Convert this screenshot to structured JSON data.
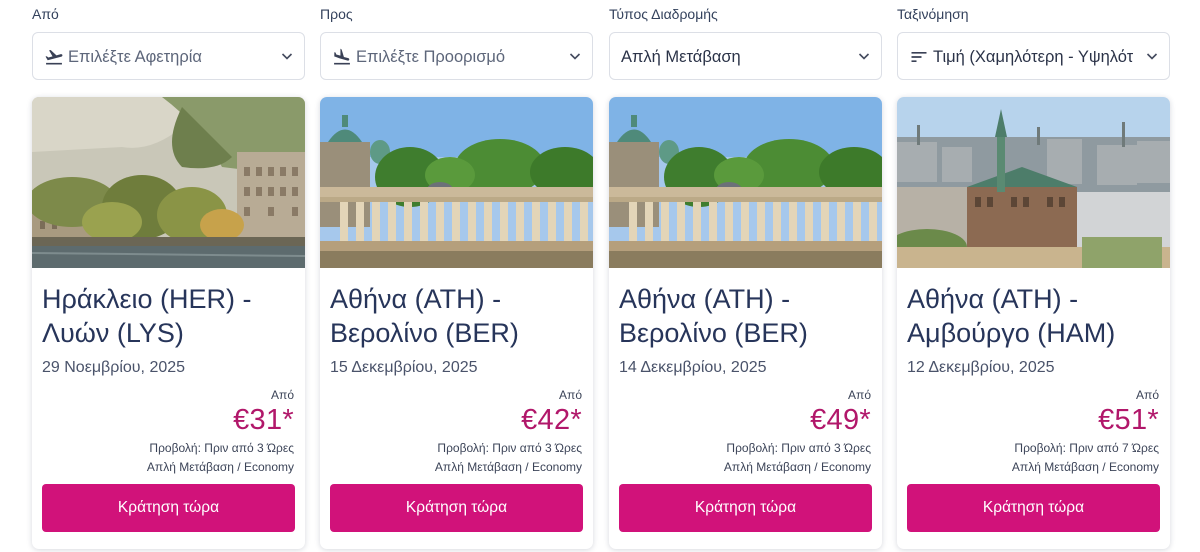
{
  "filters": [
    {
      "label": "Από",
      "value": "Επιλέξτε Αφετηρία",
      "icon": "plane-takeoff-icon",
      "is_placeholder": true
    },
    {
      "label": "Προς",
      "value": "Επιλέξτε Προορισμό",
      "icon": "plane-landing-icon",
      "is_placeholder": true
    },
    {
      "label": "Τύπος Διαδρομής",
      "value": "Απλή Μετάβαση",
      "icon": null,
      "is_placeholder": false
    },
    {
      "label": "Ταξινόμηση",
      "value": "Τιμή (Χαμηλότερη - Υψηλότ",
      "icon": "sort-icon",
      "is_placeholder": false
    }
  ],
  "cards": [
    {
      "image": "lyon-riverside-image",
      "route_line1": "Ηράκλειο (HER) -",
      "route_line2": "Λυών (LYS)",
      "date": "29 Νοεμβρίου, 2025",
      "from_label": "Από",
      "price": "€31*",
      "note": "Προβολή: Πριν από 3 Ώρες",
      "trip_info": "Απλή Μετάβαση  /  Economy",
      "button": "Κράτηση τώρα"
    },
    {
      "image": "berlin-colonnade-image",
      "route_line1": "Αθήνα (ATH) -",
      "route_line2": "Βερολίνο (BER)",
      "date": "15 Δεκεμβρίου, 2025",
      "from_label": "Από",
      "price": "€42*",
      "note": "Προβολή: Πριν από 3 Ώρες",
      "trip_info": "Απλή Μετάβαση  /  Economy",
      "button": "Κράτηση τώρα"
    },
    {
      "image": "berlin-colonnade-image",
      "route_line1": "Αθήνα (ATH) -",
      "route_line2": "Βερολίνο (BER)",
      "date": "14 Δεκεμβρίου, 2025",
      "from_label": "Από",
      "price": "€49*",
      "note": "Προβολή: Πριν από 3 Ώρες",
      "trip_info": "Απλή Μετάβαση  /  Economy",
      "button": "Κράτηση τώρα"
    },
    {
      "image": "hamburg-cityscape-image",
      "route_line1": "Αθήνα (ATH) -",
      "route_line2": "Αμβούργο (HAM)",
      "date": "12 Δεκεμβρίου, 2025",
      "from_label": "Από",
      "price": "€51*",
      "note": "Προβολή: Πριν από 7 Ώρες",
      "trip_info": "Απλή Μετάβαση  /  Economy",
      "button": "Κράτηση τώρα"
    }
  ],
  "colors": {
    "accent": "#d1127a",
    "price": "#b1176a",
    "title": "#27355a"
  }
}
